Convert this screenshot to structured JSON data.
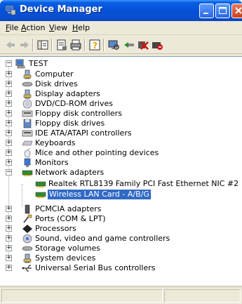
{
  "window": {
    "title": "Device Manager"
  },
  "menu": {
    "items": [
      {
        "label": "File",
        "mnemonic": "F"
      },
      {
        "label": "Action",
        "mnemonic": "A"
      },
      {
        "label": "View",
        "mnemonic": "V"
      },
      {
        "label": "Help",
        "mnemonic": "H"
      }
    ]
  },
  "toolbar": {
    "icons": [
      "back-icon",
      "forward-icon",
      "show-hide-tree-icon",
      "properties-icon",
      "print-icon",
      "help-icon",
      "scan-hardware-icon",
      "update-driver-icon",
      "uninstall-icon",
      "disable-icon"
    ]
  },
  "tree": {
    "root": "TEST",
    "categories": [
      {
        "label": "Computer",
        "icon": "computer-icon"
      },
      {
        "label": "Disk drives",
        "icon": "disk-drive-icon"
      },
      {
        "label": "Display adapters",
        "icon": "display-adapter-icon"
      },
      {
        "label": "DVD/CD-ROM drives",
        "icon": "cdrom-icon"
      },
      {
        "label": "Floppy disk controllers",
        "icon": "floppy-controller-icon"
      },
      {
        "label": "Floppy disk drives",
        "icon": "floppy-drive-icon"
      },
      {
        "label": "IDE ATA/ATAPI controllers",
        "icon": "ide-controller-icon"
      },
      {
        "label": "Keyboards",
        "icon": "keyboard-icon"
      },
      {
        "label": "Mice and other pointing devices",
        "icon": "mouse-icon"
      },
      {
        "label": "Monitors",
        "icon": "monitor-icon"
      },
      {
        "label": "Network adapters",
        "icon": "network-adapter-icon",
        "expanded": true,
        "children": [
          {
            "label": "Realtek RTL8139 Family PCI Fast Ethernet NIC #2",
            "icon": "network-card-icon"
          },
          {
            "label": "Wireless LAN Card - A/B/G",
            "icon": "network-card-icon",
            "selected": true
          }
        ]
      },
      {
        "label": "PCMCIA adapters",
        "icon": "pcmcia-icon"
      },
      {
        "label": "Ports (COM & LPT)",
        "icon": "port-icon"
      },
      {
        "label": "Processors",
        "icon": "processor-icon"
      },
      {
        "label": "Sound, video and game controllers",
        "icon": "sound-icon"
      },
      {
        "label": "Storage volumes",
        "icon": "storage-volume-icon"
      },
      {
        "label": "System devices",
        "icon": "system-device-icon"
      },
      {
        "label": "Universal Serial Bus controllers",
        "icon": "usb-icon"
      }
    ]
  },
  "colors": {
    "selection": "#316ac5",
    "titlebar": "#0551d8"
  }
}
